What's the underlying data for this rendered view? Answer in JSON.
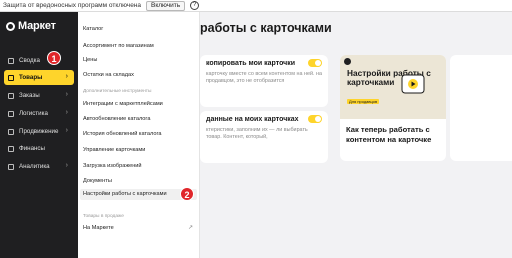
{
  "topbar": {
    "message": "Защита от вредоносных программ отключена",
    "enable_label": "Включить",
    "help_label": "?"
  },
  "sidebar": {
    "logo_text": "Маркет",
    "items": [
      {
        "label": "Сводка",
        "icon": "home-icon",
        "active": false
      },
      {
        "label": "Товары",
        "icon": "box-icon",
        "active": true
      },
      {
        "label": "Заказы",
        "icon": "cart-icon",
        "active": false
      },
      {
        "label": "Логистика",
        "icon": "truck-icon",
        "active": false
      },
      {
        "label": "Продвижение",
        "icon": "megaphone-icon",
        "active": false
      },
      {
        "label": "Финансы",
        "icon": "wallet-icon",
        "active": false
      },
      {
        "label": "Аналитика",
        "icon": "chart-icon",
        "active": false
      }
    ]
  },
  "flyout": {
    "items": [
      {
        "label": "Каталог"
      },
      {
        "label": "Ассортимент по магазинам"
      },
      {
        "label": "Цены"
      },
      {
        "label": "Остатки на складах"
      }
    ],
    "tools_caption": "Дополнительные инструменты",
    "tools": [
      {
        "label": "Интеграции с маркетплейсами"
      },
      {
        "label": "Автообновление каталога"
      },
      {
        "label": "История обновлений каталога"
      },
      {
        "label": "Управление карточками"
      },
      {
        "label": "Загрузка изображений"
      },
      {
        "label": "Документы"
      },
      {
        "label": "Настройки работы с карточками"
      }
    ],
    "other_caption": "Товары в продаже",
    "other_item": "На Маркете",
    "external_icon": "↗"
  },
  "markers": {
    "first": "1",
    "second": "2"
  },
  "main": {
    "title": "работы с карточками",
    "card1": {
      "heading": "копировать мои карточки",
      "text": "карточку вместе со всем контентом на ней. на продавцом, это не отобразится"
    },
    "card2": {
      "heading": "данные на моих карточках",
      "text": "ктеристики, заполним их — ли выбирать товар. Контент, который,"
    },
    "video": {
      "thumb_title": "Настройки работы с карточками",
      "thumb_badge": "Для продавцов",
      "caption": "Как теперь работать с контентом на карточке"
    }
  },
  "colors": {
    "accent": "#fed42b",
    "sidebar": "#1f1f21",
    "marker": "#e0262a"
  }
}
